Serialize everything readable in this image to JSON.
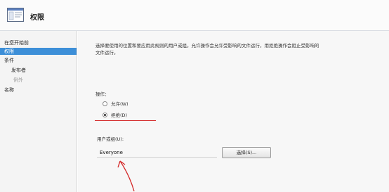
{
  "header": {
    "title": "权限",
    "icon": "window-icon"
  },
  "sidebar": {
    "items": [
      {
        "label": "在您开始前",
        "state": "normal"
      },
      {
        "label": "权限",
        "state": "active"
      },
      {
        "label": "条件",
        "state": "normal"
      },
      {
        "label": "发布者",
        "state": "normal"
      },
      {
        "label": "例外",
        "state": "disabled"
      },
      {
        "label": "名称",
        "state": "normal"
      }
    ]
  },
  "main": {
    "description": "选择要使用的位置和要应用此规则的用户或组。允许操作会允许受影响的文件运行，用拒绝操作会阻止受影响的文件运行。",
    "action_label": "操作：",
    "options": [
      {
        "label": "允许(W)",
        "checked": false
      },
      {
        "label": "拒绝(D)",
        "checked": true
      }
    ],
    "users_label": "用户或组(U):",
    "users_value": "Everyone",
    "select_button": "选择(S)..."
  },
  "colors": {
    "active_nav": "#3d8fd8",
    "annotation": "#d42828"
  }
}
